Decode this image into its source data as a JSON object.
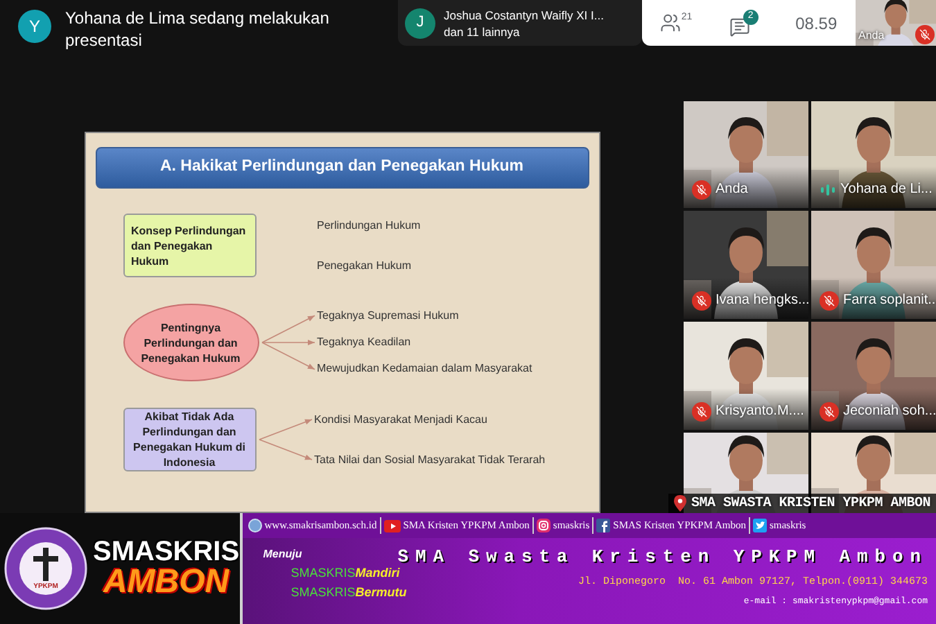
{
  "presenter_notice": {
    "avatar": "Y",
    "text": "Yohana de Lima sedang melakukan presentasi"
  },
  "join_notice": {
    "avatar": "J",
    "name": "Joshua Costantyn Waifly XI I...",
    "more": "dan 11 lainnya"
  },
  "toolbar": {
    "participants_count": "21",
    "chat_badge": "2",
    "time": "08.59"
  },
  "self_view": {
    "name": "Anda",
    "muted": true
  },
  "slide": {
    "title": "A. Hakikat Perlindungan dan Penegakan Hukum",
    "groups": [
      {
        "kind": "box",
        "color": "#e6f5a8",
        "label": "Konsep Perlindungan dan Penegakan Hukum",
        "arrows": false,
        "items": [
          "Perlindungan Hukum",
          "Penegakan Hukum"
        ]
      },
      {
        "kind": "oval",
        "color": "#f4a3a3",
        "label": "Pentingnya Perlindungan dan Penegakan Hukum",
        "arrows": true,
        "items": [
          "Tegaknya Supremasi Hukum",
          "Tegaknya Keadilan",
          "Mewujudkan Kedamaian dalam Masyarakat"
        ]
      },
      {
        "kind": "box",
        "color": "#cdc6f0",
        "label": "Akibat Tidak Ada Perlindungan dan Penegakan Hukum di Indonesia",
        "arrows": true,
        "items": [
          "Kondisi Masyarakat Menjadi Kacau",
          "Tata Nilai dan Sosial Masyarakat Tidak Terarah"
        ]
      }
    ]
  },
  "tiles": [
    {
      "kind": "participant",
      "name": "Anda",
      "muted": true,
      "speaking": false
    },
    {
      "kind": "participant",
      "name": "Yohana de Li...",
      "muted": false,
      "speaking": true
    },
    {
      "kind": "participant",
      "name": "Ivana hengks...",
      "muted": true,
      "speaking": false
    },
    {
      "kind": "participant",
      "name": "Farra soplanit...",
      "muted": true,
      "speaking": false
    },
    {
      "kind": "participant",
      "name": "Krisyanto.M....",
      "muted": true,
      "speaking": false
    },
    {
      "kind": "participant",
      "name": "Jeconiah soh...",
      "muted": true,
      "speaking": false
    },
    {
      "kind": "picture"
    },
    {
      "kind": "picture"
    }
  ],
  "ticker": "SMA SWASTA KRISTEN YPKPM AMBON",
  "banner": {
    "emblem_text": "YPKPM",
    "brand": [
      "SMASKRIS",
      "AMBON"
    ],
    "links": [
      {
        "kind": "web",
        "text": "www.smakrisambon.sch.id"
      },
      {
        "kind": "youtube",
        "text": "SMA Kristen YPKPM Ambon"
      },
      {
        "kind": "instagram",
        "text": "smaskris"
      },
      {
        "kind": "facebook",
        "text": "SMAS Kristen YPKPM Ambon"
      },
      {
        "kind": "twitter",
        "text": "smaskris"
      }
    ],
    "school_name": "SMA Swasta Kristen YPKPM Ambon",
    "motto_lead": "Menuju",
    "motto": [
      {
        "prefix": "SMASKRIS",
        "word": "Mandiri"
      },
      {
        "prefix": "SMASKRIS",
        "word": "Bermutu"
      }
    ],
    "address": "Jl. Diponegoro  No. 61 Ambon 97127, Telpon.(0911) 344673",
    "email": "e-mail : smakristenypkpm@gmail.com"
  }
}
